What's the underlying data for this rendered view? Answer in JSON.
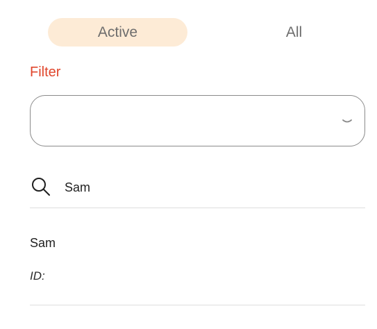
{
  "tabs": {
    "active_label": "Active",
    "all_label": "All"
  },
  "filter": {
    "label": "Filter",
    "selected_value": ""
  },
  "search": {
    "value": "Sam",
    "placeholder": ""
  },
  "results": [
    {
      "name": "Sam",
      "id_label": "ID:",
      "id_value": ""
    }
  ],
  "colors": {
    "accent": "#e0462c",
    "active_tab_bg": "#fdebd6",
    "border": "#8a8a8a",
    "divider": "#dedede"
  },
  "icons": {
    "search": "search-icon",
    "dropdown": "chevron-down-icon"
  }
}
